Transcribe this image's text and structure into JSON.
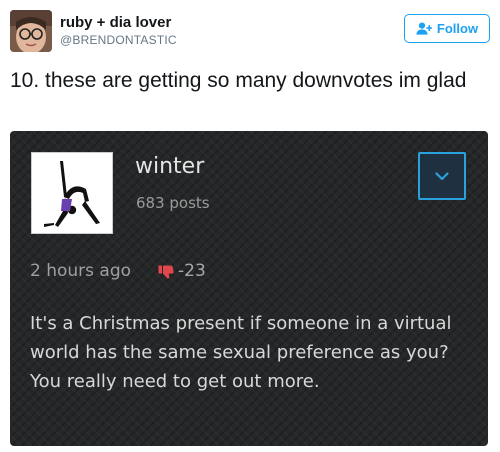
{
  "tweet": {
    "author_name": "ruby + dia lover",
    "author_handle": "@BRENDONTASTIC",
    "follow_label": "Follow",
    "text": "10. these are getting so many downvotes im glad"
  },
  "post": {
    "username": "winter",
    "post_count": "683 posts",
    "time": "2 hours ago",
    "score": "-23",
    "body": "It's a Christmas present if someone in a virtual world has the same sexual preference as you? You really need to get out more."
  },
  "colors": {
    "accent": "#1da1f2",
    "dark_card": "#252729",
    "chevron_border": "#29a2de",
    "downvote": "#e0474c"
  },
  "icons": {
    "follow": "person-plus-icon",
    "expand": "chevron-down-icon",
    "vote": "thumbs-down-icon"
  }
}
